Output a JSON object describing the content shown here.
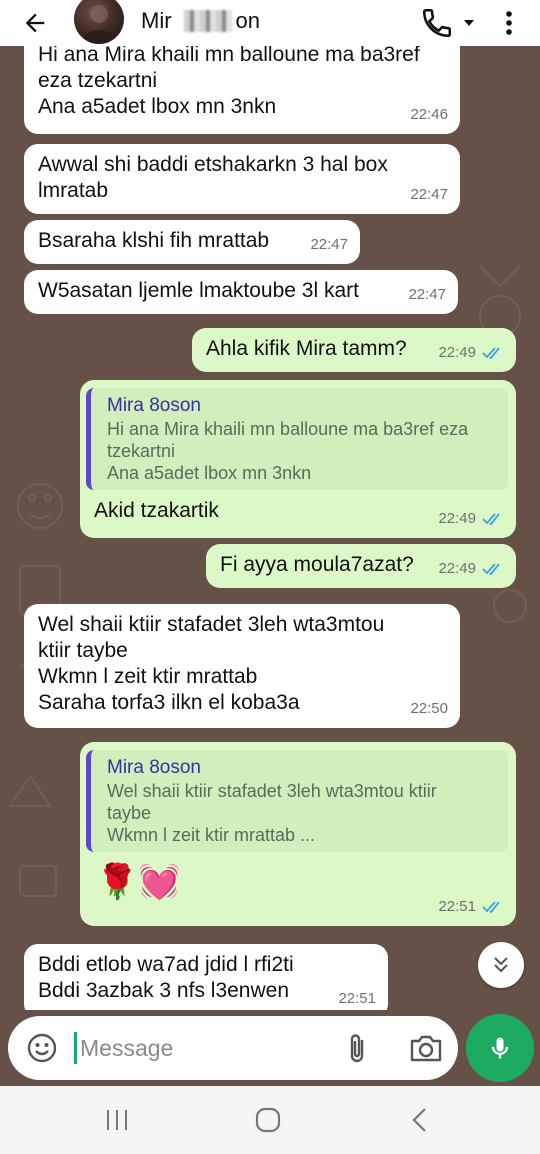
{
  "header": {
    "contact_name_start": "Mir",
    "contact_name_end": "on"
  },
  "messages": [
    {
      "text": "Hi ana Mira khaili mn balloune ma ba3ref\neza tzekartni\nAna a5adet lbox mn 3nkn",
      "time": "22:46"
    },
    {
      "text": "Awwal shi baddi etshakarkn 3 hal box\nlmratab",
      "time": "22:47"
    },
    {
      "text": "Bsaraha klshi fih mrattab",
      "time": "22:47"
    },
    {
      "text": "W5asatan ljemle lmaktoube 3l kart",
      "time": "22:47"
    },
    {
      "text": "Ahla kifik Mira tamm?",
      "time": "22:49"
    },
    {
      "quote_author": "Mira 8oson",
      "quote_text": "Hi ana Mira khaili mn balloune ma ba3ref eza\ntzekartni\nAna a5adet lbox mn 3nkn",
      "text": "Akid tzakartik",
      "time": "22:49"
    },
    {
      "text": "Fi ayya moula7azat?",
      "time": "22:49"
    },
    {
      "text": "Wel shaii ktiir stafadet 3leh wta3mtou\nktiir taybe\nWkmn l zeit ktir mrattab\nSaraha torfa3 ilkn el koba3a",
      "time": "22:50"
    },
    {
      "quote_author": "Mira 8oson",
      "quote_text": "Wel shaii ktiir stafadet 3leh wta3mtou ktiir\ntaybe\nWkmn l zeit ktir mrattab ...",
      "text": "🌹💓",
      "time": "22:51"
    },
    {
      "text": "Bddi etlob wa7ad jdid l rfi2ti\nBddi 3azbak 3 nfs l3enwen",
      "time": "22:51"
    }
  ],
  "composer": {
    "placeholder": "Message"
  },
  "icons": {
    "back": "arrow-left-icon",
    "call": "phone-icon",
    "menu": "more-vert-icon",
    "emoji": "sticker-icon",
    "attach": "paperclip-icon",
    "camera": "camera-icon",
    "mic": "mic-icon",
    "scroll": "double-chevron-down-icon"
  },
  "colors": {
    "chat_background": "#655148",
    "incoming_bubble": "#ffffff",
    "outgoing_bubble": "#dcf8c6",
    "read_ticks": "#34a3e0",
    "accent": "#1daa61",
    "quote_bar": "#5d47c8"
  }
}
